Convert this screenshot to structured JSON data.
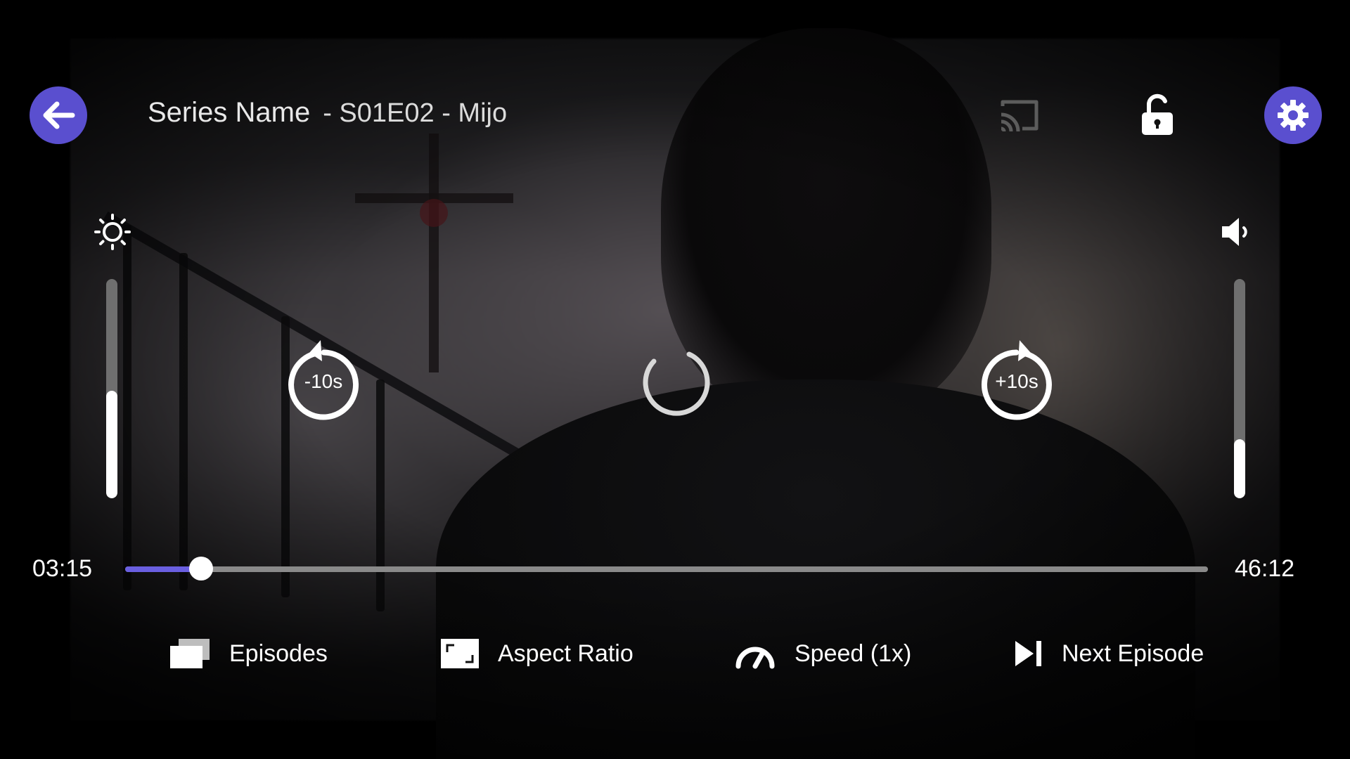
{
  "header": {
    "series_name": "Series Name",
    "episode_info": "- S01E02 - Mijo"
  },
  "icons": {
    "back": "arrow-left-icon",
    "cast": "cast-icon",
    "lock": "unlock-icon",
    "settings": "gear-icon",
    "brightness": "sun-icon",
    "volume": "speaker-icon",
    "rewind": "replay-icon",
    "loading": "spinner-icon",
    "forward": "forward-icon"
  },
  "brightness": {
    "level": 0.49
  },
  "volume": {
    "level": 0.27
  },
  "controls": {
    "rewind_label": "-10s",
    "forward_label": "+10s"
  },
  "playback": {
    "current_time": "03:15",
    "total_time": "46:12",
    "progress": 0.07
  },
  "menu": {
    "episodes": "Episodes",
    "aspect_ratio": "Aspect Ratio",
    "speed": "Speed (1x)",
    "next_episode": "Next Episode"
  },
  "colors": {
    "accent": "#5a4fcf",
    "progress_fill": "#6a5fe0",
    "track": "#8a8a8a"
  }
}
